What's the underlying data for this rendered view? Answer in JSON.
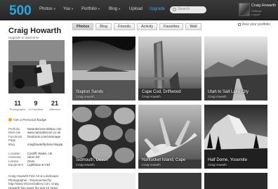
{
  "nav": {
    "logo_text": "500",
    "items": [
      {
        "label": "Photos",
        "caret": "▼"
      },
      {
        "label": "You",
        "caret": "▼"
      },
      {
        "label": "Portfolio",
        "caret": "▼"
      },
      {
        "label": "Blog",
        "caret": "▼"
      },
      {
        "label": "Upload",
        "caret": ""
      },
      {
        "label": "Upgrade",
        "caret": ""
      }
    ],
    "search_placeholder": "Search",
    "user": {
      "name": "Craig Howarth",
      "link1": "Settings",
      "link2": "Logout"
    }
  },
  "profile": {
    "name": "Craig Howarth",
    "tagline": "Upgrade to awesome",
    "view_portfolio": "View your portfolio"
  },
  "tabs": [
    "Photos",
    "Blog",
    "Friends",
    "Activity",
    "Favorites",
    "Wall"
  ],
  "stats": [
    {
      "value": "11",
      "label": "Photographs"
    },
    {
      "value": "9",
      "label": "In Favorites"
    },
    {
      "value": "21",
      "label": "Affection"
    }
  ],
  "badge_text": "Get a Personal Badge",
  "links": [
    {
      "key": "Portfolio",
      "value": "Naturalscene.500px.com"
    },
    {
      "key": "Web-site",
      "value": "www.naturalscene.co.uk"
    },
    {
      "key": "Facebook",
      "value": "facebook.com/visionage"
    },
    {
      "key": "Page",
      "value": ""
    },
    {
      "key": "Blog",
      "value": "craighowarthphoto.blogsp"
    }
  ],
  "details": [
    {
      "key": "Location",
      "value": "Cardiff, Wales, Uk"
    },
    {
      "key": "Cameras",
      "value": "nikon D3"
    },
    {
      "key": "Lenses",
      "value": "Zeiss"
    },
    {
      "key": "Equipment",
      "value": "Lightbase & C54"
    }
  ],
  "bio": "Craig Howarth Fine Art & Landscape Photographer - Represented by http://www.VisionsGallery.com. Craig Howarth has spent the last 15 Years",
  "photos": [
    {
      "title": "Slapton Sands",
      "author": "Craig Howarth"
    },
    {
      "title": "Cape Cod, Driftwood",
      "author": "Craig Howarth"
    },
    {
      "title": "Utah to Salt Lake City",
      "author": "Craig Howarth"
    },
    {
      "title": "Sidmouth, Devon",
      "author": "Craig Howarth"
    },
    {
      "title": "Nantucket Island, Cape",
      "author": "Craig Howarth"
    },
    {
      "title": "Half Dome, Yosemite",
      "author": "Craig Howarth"
    }
  ],
  "colors": {
    "nav_bg": "#2e2e2e",
    "accent": "#3fa9f5",
    "logo": "#2aa7e0"
  }
}
